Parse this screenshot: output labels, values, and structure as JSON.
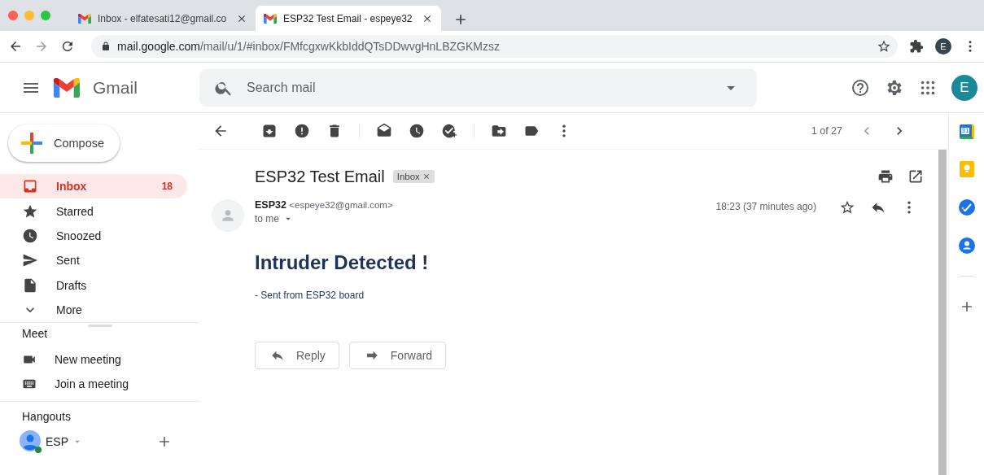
{
  "browser": {
    "tabs": [
      {
        "title": "Inbox - elfatesati12@gmail.co",
        "selected": false
      },
      {
        "title": "ESP32 Test Email - espeye32",
        "selected": true
      }
    ],
    "url": {
      "host": "mail.google.com",
      "path": "/mail/u/1/#inbox/FMfcgxwKkbIddQTsDDwvgHnLBZGKMzsz"
    },
    "profile_initial": "E"
  },
  "header": {
    "product": "Gmail",
    "search": {
      "placeholder": "Search mail"
    },
    "account_initial": "E"
  },
  "sidebar": {
    "compose": "Compose",
    "folders": [
      {
        "label": "Inbox",
        "count": "18",
        "selected": true
      },
      {
        "label": "Starred",
        "selected": false
      },
      {
        "label": "Snoozed",
        "selected": false
      },
      {
        "label": "Sent",
        "selected": false
      },
      {
        "label": "Drafts",
        "selected": false
      },
      {
        "label": "More",
        "selected": false
      }
    ],
    "meet": {
      "title": "Meet",
      "items": [
        "New meeting",
        "Join a meeting"
      ]
    },
    "hangouts": {
      "title": "Hangouts",
      "user": "ESP"
    }
  },
  "toolbar": {
    "pager": "1 of 27"
  },
  "message": {
    "subject": "ESP32 Test Email",
    "label": "Inbox",
    "sender_name": "ESP32",
    "sender_email": "<espeye32@gmail.com>",
    "recipient": "to me",
    "time": "18:23 (37 minutes ago)",
    "heading": "Intruder Detected !",
    "body": "- Sent from ESP32 board",
    "actions": [
      "Reply",
      "Forward"
    ]
  },
  "side_panel": {
    "calendar_day": "31"
  }
}
